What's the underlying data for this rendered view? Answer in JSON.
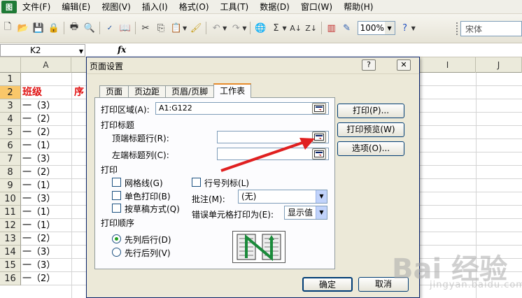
{
  "menubar": {
    "items": [
      "文件(F)",
      "编辑(E)",
      "视图(V)",
      "插入(I)",
      "格式(O)",
      "工具(T)",
      "数据(D)",
      "窗口(W)",
      "帮助(H)"
    ]
  },
  "toolbar": {
    "zoom": "100%",
    "font_name": "宋体"
  },
  "formula_bar": {
    "name_box": "K2",
    "fx": "fx",
    "value": ""
  },
  "sheet": {
    "columns": [
      "A",
      "I",
      "J"
    ],
    "rows": [
      "1",
      "2",
      "3",
      "4",
      "5",
      "6",
      "7",
      "8",
      "9",
      "10",
      "11",
      "12",
      "13",
      "14",
      "15",
      "16"
    ],
    "col_a_values": [
      "",
      "班级",
      "一（3）",
      "一（2）",
      "一（2）",
      "一（1）",
      "一（3）",
      "一（2）",
      "一（1）",
      "一（3）",
      "一（1）",
      "一（1）",
      "一（2）",
      "一（3）",
      "一（3）",
      "一（2）"
    ],
    "col_b_header": "序",
    "header_color": "#e01010",
    "selected_row_color": "#f9c76a"
  },
  "dialog": {
    "title": "页面设置",
    "help_btn": "?",
    "close_btn": "✕",
    "tabs": [
      "页面",
      "页边距",
      "页眉/页脚",
      "工作表"
    ],
    "active_tab": "工作表",
    "print_area_label": "打印区域(A):",
    "print_area_value": "A1:G122",
    "print_titles_group": "打印标题",
    "top_rows_label": "顶端标题行(R):",
    "top_rows_value": "",
    "left_cols_label": "左端标题列(C):",
    "left_cols_value": "",
    "print_group": "打印",
    "gridlines_label": "网格线(G)",
    "mono_label": "单色打印(B)",
    "draft_label": "按草稿方式(Q)",
    "rowcol_label": "行号列标(L)",
    "comments_label": "批注(M):",
    "comments_value": "(无)",
    "errors_label": "错误单元格打印为(E):",
    "errors_value": "显示值",
    "order_group": "打印顺序",
    "down_then_over": "先列后行(D)",
    "over_then_down": "先行后列(V)",
    "btn_print": "打印(P)...",
    "btn_preview": "打印预览(W)",
    "btn_options": "选项(O)...",
    "btn_ok": "确定",
    "btn_cancel": "取消",
    "annotation_color": "#e02020"
  },
  "watermark": {
    "text": "Bai 经验",
    "url": "jingyan.baidu.com"
  }
}
